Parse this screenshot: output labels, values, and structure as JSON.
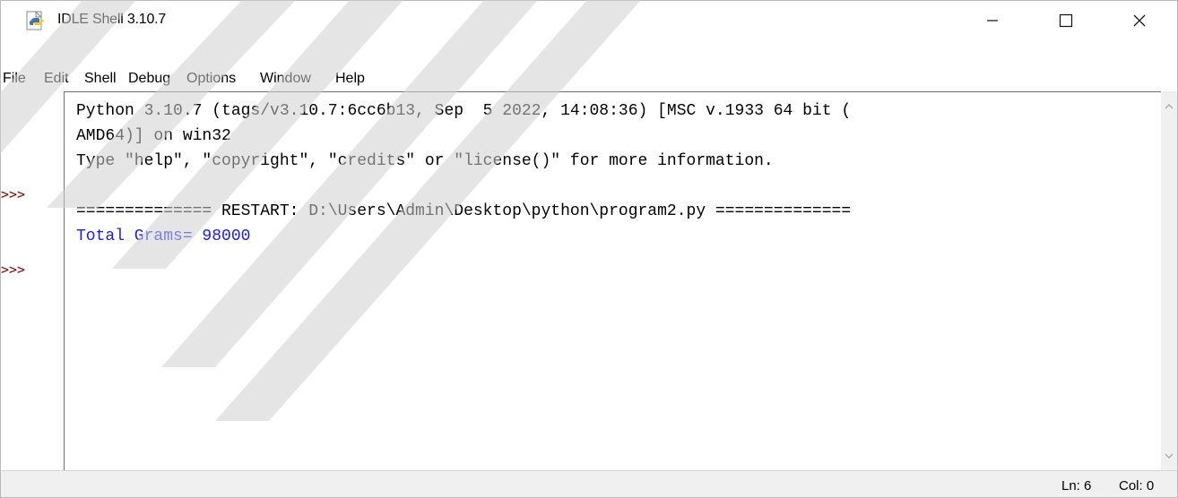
{
  "window": {
    "title": "IDLE Shell 3.10.7",
    "icon": "python-idle-icon",
    "controls": {
      "minimize": "minimize-icon",
      "maximize": "maximize-icon",
      "close": "close-icon"
    }
  },
  "menu": [
    "File",
    "Edit",
    "Shell",
    "Debug",
    "Options",
    "Window",
    "Help"
  ],
  "shell": {
    "prompt": ">>>",
    "lines": [
      "Python 3.10.7 (tags/v3.10.7:6cc6b13, Sep  5 2022, 14:08:36) [MSC v.1933 64 bit (",
      "AMD64)] on win32",
      "Type \"help\", \"copyright\", \"credits\" or \"license()\" for more information.",
      "============== RESTART: D:\\Users\\Admin\\Desktop\\python\\program2.py ==============",
      "Total Grams= 98000"
    ]
  },
  "status": {
    "line": "Ln: 6",
    "column": "Col: 0"
  },
  "colors": {
    "prompt": "#8b0000",
    "stdout": "#1a1aff",
    "watermark": "#d0d0d0"
  }
}
